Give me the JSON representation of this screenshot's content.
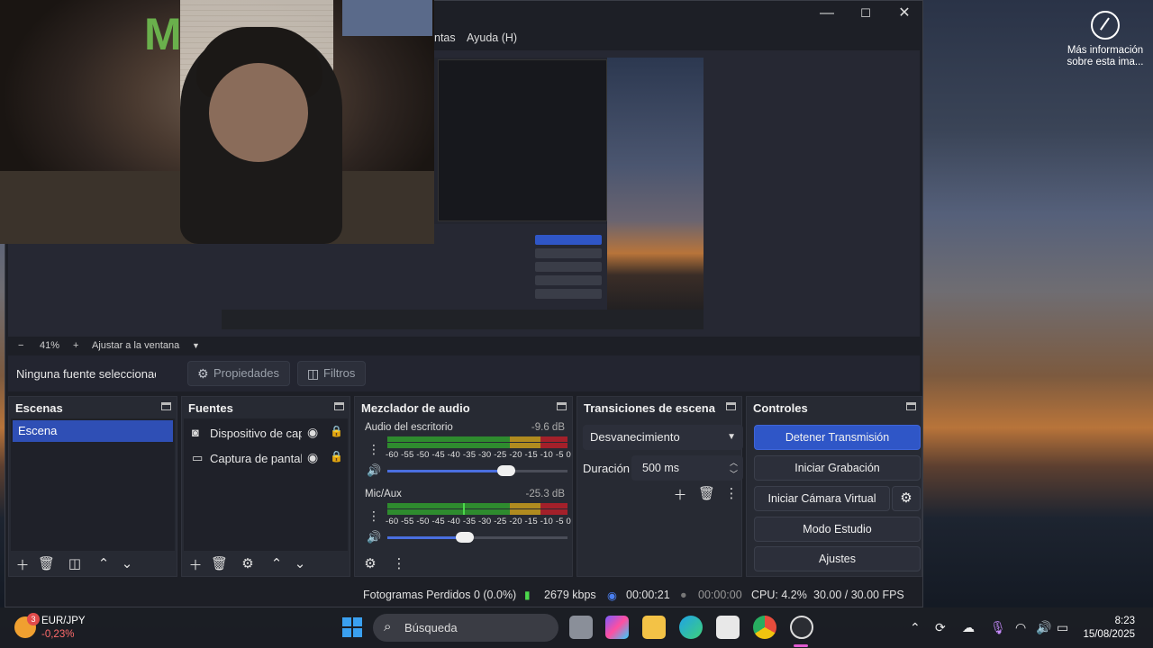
{
  "desktop": {
    "wallpaper_info": "Más información sobre esta ima..."
  },
  "window": {
    "menu": {
      "tools_partial": "ntas",
      "help": "Ayuda (H)"
    },
    "controls": {
      "minimize": "—",
      "maximize": "☐",
      "close": "✕"
    }
  },
  "preview": {
    "zoom": "41%",
    "zoom_minus": "−",
    "zoom_plus": "+",
    "fit_label": "Ajustar a la ventana"
  },
  "source_toolbar": {
    "no_source": "Ninguna fuente seleccionada",
    "properties": "Propiedades",
    "filters": "Filtros"
  },
  "scenes": {
    "title": "Escenas",
    "items": [
      "Escena"
    ]
  },
  "sources": {
    "title": "Fuentes",
    "items": [
      {
        "name": "Dispositivo de captura de video",
        "icon": "camera-icon"
      },
      {
        "name": "Captura de pantalla",
        "icon": "monitor-icon"
      }
    ]
  },
  "mixer": {
    "title": "Mezclador de audio",
    "scale": "-60 -55 -50 -45 -40 -35 -30 -25 -20 -15 -10  -5   0",
    "channels": [
      {
        "name": "Audio del escritorio",
        "db": "-9.6 dB",
        "volume": 0.66
      },
      {
        "name": "Mic/Aux",
        "db": "-25.3 dB",
        "volume": 0.43
      }
    ]
  },
  "transitions": {
    "title": "Transiciones de escena",
    "selected": "Desvanecimiento",
    "duration_label": "Duración",
    "duration_value": "500 ms"
  },
  "controls": {
    "title": "Controles",
    "stop_stream": "Detener Transmisión",
    "start_recording": "Iniciar Grabación",
    "start_virtual_cam": "Iniciar Cámara Virtual",
    "studio_mode": "Modo Estudio",
    "settings": "Ajustes"
  },
  "status": {
    "dropped_frames": "Fotogramas Perdidos 0 (0.0%)",
    "bitrate": "2679 kbps",
    "stream_time": "00:00:21",
    "rec_time": "00:00:00",
    "cpu": "CPU: 4.2%",
    "fps": "30.00 / 30.00 FPS"
  },
  "taskbar": {
    "widget_badge": "3",
    "widget_title": "EUR/JPY",
    "widget_value": "-0,23%",
    "search_placeholder": "Búsqueda",
    "time": "8:23",
    "date": "15/08/2025",
    "colors": {
      "accent": "#2f56c7",
      "loss": "#ff6b6b"
    }
  }
}
